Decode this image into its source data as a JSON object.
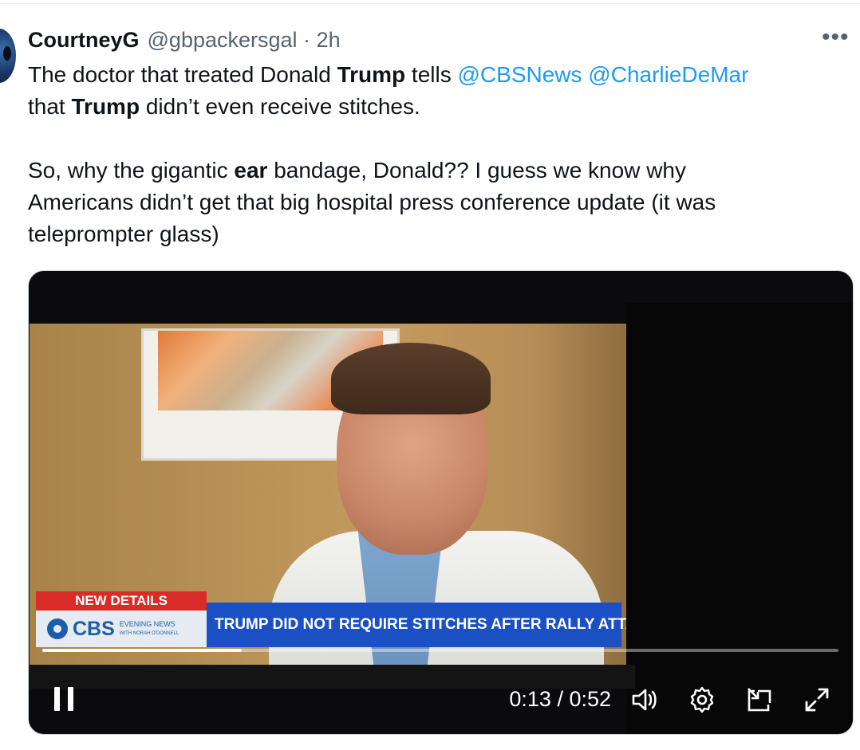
{
  "tweet": {
    "author_name": "CourtneyG",
    "author_handle": "@gbpackersgal",
    "separator": "·",
    "time_ago": "2h",
    "more_icon": "more-horizontal-icon",
    "text": {
      "l1_a": "The doctor that treated Donald ",
      "l1_bold": "Trump",
      "l1_b": " tells ",
      "mention1": "@CBSNews",
      "mention2": "@CharlieDeMar",
      "l2_a": "that ",
      "l2_bold": "Trump",
      "l2_b": " didn’t even receive stitches.",
      "l3_a": "So, why the gigantic ",
      "l3_bold": "ear",
      "l3_b": " bandage, Donald?? I guess we know why",
      "l4": "Americans didn’t get that big hospital press conference update  (it was",
      "l5": "teleprompter glass)"
    }
  },
  "video": {
    "chyron_tag": "NEW DETAILS",
    "network": "CBS",
    "program_line1": "EVENING NEWS",
    "program_line2": "WITH NORAH O'DONNELL",
    "headline": "TRUMP DID NOT REQUIRE STITCHES AFTER RALLY ATTACK",
    "current_time": "0:13",
    "duration": "0:52",
    "time_display": "0:13 / 0:52",
    "progress_fraction": 0.25,
    "icons": [
      "pause-icon",
      "volume-icon",
      "settings-gear-icon",
      "picture-in-picture-icon",
      "fullscreen-icon"
    ]
  },
  "colors": {
    "mention": "#1d9bf0",
    "secondary_text": "#536471",
    "chyron_red": "#d92b27",
    "chyron_blue": "#1b4fc4"
  }
}
